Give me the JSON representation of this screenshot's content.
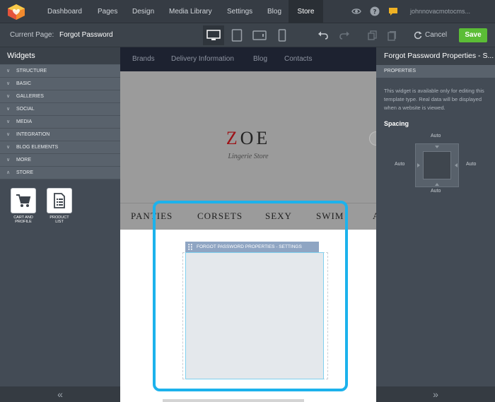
{
  "nav": {
    "items": [
      "Dashboard",
      "Pages",
      "Design",
      "Media Library",
      "Settings",
      "Blog",
      "Store"
    ],
    "active": "Store",
    "user": "johnnovacmotocms..."
  },
  "toolbar": {
    "current_page_label": "Current Page:",
    "current_page_name": "Forgot Password",
    "cancel_label": "Cancel",
    "save_label": "Save"
  },
  "left_panel": {
    "title": "Widgets",
    "categories": [
      "STRUCTURE",
      "BASIC",
      "GALLERIES",
      "SOCIAL",
      "MEDIA",
      "INTEGRATION",
      "BLOG ELEMENTS",
      "MORE",
      "STORE"
    ],
    "store_widgets": [
      {
        "label": "CART AND PROFILE",
        "icon": "cart-icon"
      },
      {
        "label": "PRODUCT LIST",
        "icon": "product-list-icon"
      }
    ],
    "collapse_glyph": "«"
  },
  "site": {
    "links": [
      "Brands",
      "Delivery Information",
      "Blog",
      "Contacts"
    ],
    "brand_first": "Z",
    "brand_rest": "OE",
    "tagline": "Lingerie Store",
    "menu": [
      "PANTIES",
      "CORSETS",
      "SEXY",
      "SWIM",
      "A"
    ],
    "widget_tag": "FORGOT PASSWORD PROPERTIES - SETTINGS"
  },
  "right_panel": {
    "title": "Forgot Password Properties - S...",
    "section": "PROPERTIES",
    "note": "This widget is available only for editing this template type. Real data will be displayed when a website is viewed.",
    "spacing_label": "Spacing",
    "spacing": {
      "top": "Auto",
      "left": "Auto",
      "right": "Auto",
      "bottom": "Auto"
    },
    "expand_glyph": "»"
  },
  "colors": {
    "accent": "#1cb2ec",
    "save": "#5bbd36",
    "brand_red": "#9d1318"
  }
}
